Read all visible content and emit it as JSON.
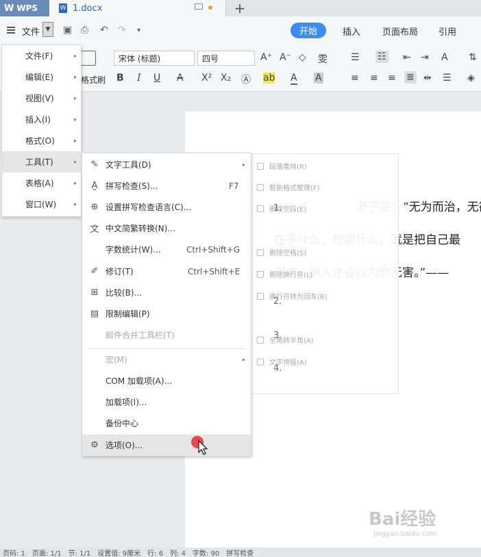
{
  "titlebar": {
    "app_tab": "WPS",
    "doc_tab": "1.docx",
    "new_tab": "+"
  },
  "menubar": {
    "file_label": "文件",
    "ribbon_tabs": [
      {
        "label": "开始",
        "active": true
      },
      {
        "label": "插入",
        "active": false
      },
      {
        "label": "页面布局",
        "active": false
      },
      {
        "label": "引用",
        "active": false
      }
    ]
  },
  "toolbar": {
    "font_name": "宋体 (标题)",
    "font_size": "四号",
    "format_painter_label": "格式刷",
    "accent_color": "#3b8df0"
  },
  "main_menu": {
    "items": [
      {
        "label": "文件(F)",
        "has_submenu": true,
        "selected": false
      },
      {
        "label": "编辑(E)",
        "has_submenu": true,
        "selected": false
      },
      {
        "label": "视图(V)",
        "has_submenu": true,
        "selected": false
      },
      {
        "label": "插入(I)",
        "has_submenu": true,
        "selected": false
      },
      {
        "label": "格式(O)",
        "has_submenu": true,
        "selected": false
      },
      {
        "label": "工具(T)",
        "has_submenu": true,
        "selected": true
      },
      {
        "label": "表格(A)",
        "has_submenu": true,
        "selected": false
      },
      {
        "label": "窗口(W)",
        "has_submenu": true,
        "selected": false
      }
    ]
  },
  "tools_menu": {
    "items": [
      {
        "label": "文字工具(D)",
        "shortcut": "",
        "icon": "wrench-icon",
        "has_submenu": true,
        "disabled": false,
        "highlighted": false
      },
      {
        "label": "拼写检查(S)...",
        "shortcut": "F7",
        "icon": "spellcheck-icon",
        "has_submenu": false,
        "disabled": false,
        "highlighted": false
      },
      {
        "label": "设置拼写检查语言(C)...",
        "shortcut": "",
        "icon": "globe-icon",
        "has_submenu": false,
        "disabled": false,
        "highlighted": false
      },
      {
        "label": "中文简繁转换(N)...",
        "shortcut": "",
        "icon": "convert-icon",
        "has_submenu": false,
        "disabled": false,
        "highlighted": false
      },
      {
        "label": "字数统计(W)...",
        "shortcut": "Ctrl+Shift+G",
        "icon": "",
        "has_submenu": false,
        "disabled": false,
        "highlighted": false
      },
      {
        "label": "修订(T)",
        "shortcut": "Ctrl+Shift+E",
        "icon": "revision-icon",
        "has_submenu": false,
        "disabled": false,
        "highlighted": false
      },
      {
        "label": "比较(B)...",
        "shortcut": "",
        "icon": "compare-icon",
        "has_submenu": false,
        "disabled": false,
        "highlighted": false
      },
      {
        "label": "限制编辑(P)",
        "shortcut": "",
        "icon": "restrict-edit-icon",
        "has_submenu": false,
        "disabled": false,
        "highlighted": false
      },
      {
        "label": "邮件合并工具栏(T)",
        "shortcut": "",
        "icon": "",
        "has_submenu": false,
        "disabled": true,
        "highlighted": false
      },
      {
        "label": "宏(M)",
        "shortcut": "",
        "icon": "",
        "has_submenu": true,
        "disabled": true,
        "highlighted": false
      },
      {
        "label": "COM 加载项(A)...",
        "shortcut": "",
        "icon": "",
        "has_submenu": false,
        "disabled": false,
        "highlighted": false
      },
      {
        "label": "加载项(I)...",
        "shortcut": "",
        "icon": "",
        "has_submenu": false,
        "disabled": false,
        "highlighted": false
      },
      {
        "label": "备份中心",
        "shortcut": "",
        "icon": "",
        "has_submenu": false,
        "disabled": false,
        "highlighted": false
      },
      {
        "label": "选项(O)...",
        "shortcut": "",
        "icon": "gear-icon",
        "has_submenu": false,
        "disabled": false,
        "highlighted": true
      }
    ]
  },
  "text_tools_submenu": {
    "items": [
      "段落重排(R)",
      "智能格式整理(F)",
      "删除空段(E)",
      "删除空格(S)",
      "删除换行符(L)",
      "换行符转为回车(B)",
      "全角转半角(A)",
      "文字排版(A)"
    ]
  },
  "document": {
    "lines": [
      "老子说：“无为而治，无欲",
      "在乎什么，想要什么，就是把自己最",
      "无求，别人才会以为你无害。”——"
    ],
    "list_markers": [
      "1.",
      "2.",
      "3.",
      "4."
    ]
  },
  "statusbar": {
    "items": [
      "页码: 1",
      "页面: 1/1",
      "节: 1/1",
      "设置值: 9厘米",
      "行: 6",
      "列: 4",
      "字数: 90",
      "拼写检查"
    ]
  },
  "watermark": {
    "brand": "Bai经验",
    "url": "jingyan.baidu.com"
  }
}
